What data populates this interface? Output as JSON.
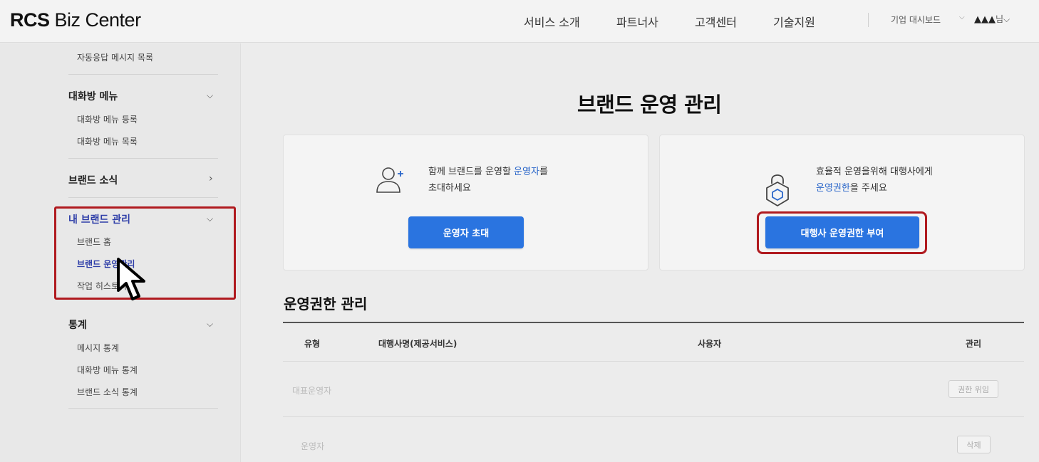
{
  "header": {
    "logo_bold": "RCS",
    "logo_rest": " Biz Center",
    "nav": [
      "서비스 소개",
      "파트너사",
      "고객센터",
      "기술지원"
    ],
    "dashboard": "기업 대시보드",
    "user_name": "▲▲▲",
    "user_suffix": "님"
  },
  "sidebar": {
    "top_item": "자동응답 메시지 목록",
    "groups": [
      {
        "label": "대화방 메뉴",
        "items": [
          "대화방 메뉴 등록",
          "대화방 메뉴 목록"
        ]
      },
      {
        "label": "브랜드 소식",
        "items": []
      },
      {
        "label": "내 브랜드 관리",
        "items": [
          "브랜드 홈",
          "브랜드 운영관리",
          "작업 히스토리"
        ]
      },
      {
        "label": "통계",
        "items": [
          "메시지 통계",
          "대화방 메뉴 통계",
          "브랜드 소식 통계"
        ]
      }
    ]
  },
  "main": {
    "title": "브랜드 운영 관리",
    "card_invite": {
      "line1_pre": "함께 브랜드를 운영할 ",
      "line1_em": "운영자",
      "line1_post": "를",
      "line2": "초대하세요",
      "button": "운영자 초대"
    },
    "card_agency": {
      "line1": "효율적 운영을위해 대행사에게",
      "line2_em": "운영권한",
      "line2_post": "을 주세요",
      "button": "대행사 운영권한 부여"
    },
    "section_title": "운영권한 관리",
    "table": {
      "headers": [
        "유형",
        "대행사명(제공서비스)",
        "사용자",
        "관리"
      ],
      "rows": [
        {
          "type": "대표운영자",
          "action": "권한 위임"
        },
        {
          "type": "운영자",
          "action": "삭제"
        }
      ]
    }
  },
  "colors": {
    "accent": "#2a74e0",
    "highlight": "#b01a1f",
    "active_nav": "#2e3ea8"
  }
}
